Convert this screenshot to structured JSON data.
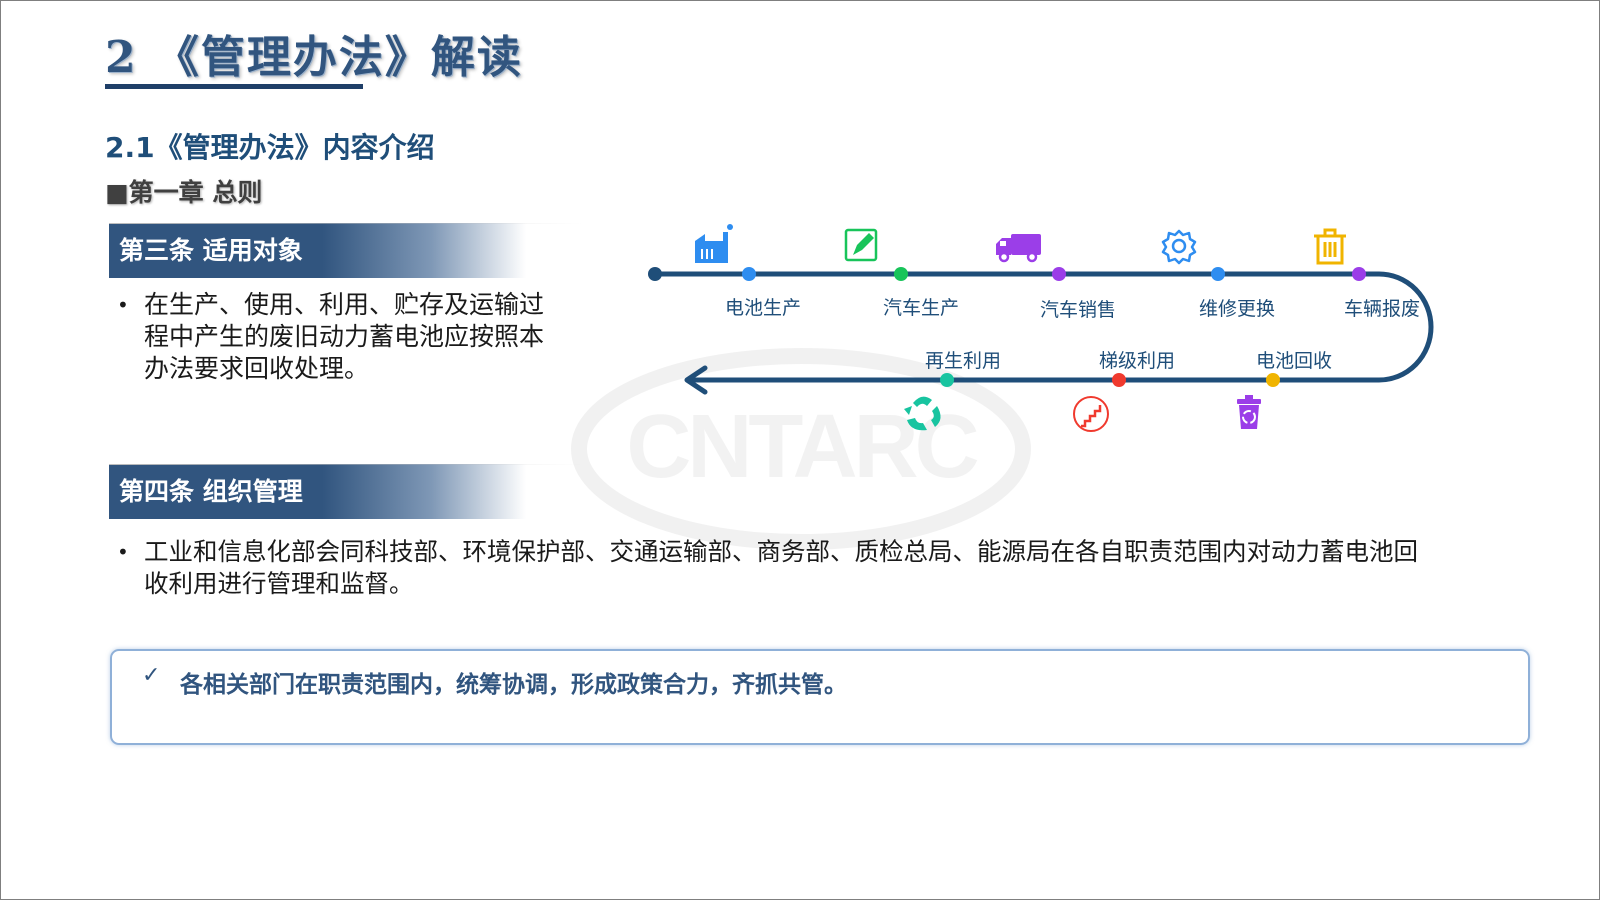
{
  "header": {
    "title": "2 《管理办法》解读",
    "subtitle": "2.1《管理办法》内容介绍",
    "chapter": "■第一章 总则"
  },
  "article3": {
    "heading": "第三条 适用对象",
    "bullet_symbol": "•",
    "lines": [
      "在生产、使用、利用、贮存及运输过",
      "程中产生的废旧动力蓄电池应按照本",
      "办法要求回收处理。"
    ]
  },
  "article4": {
    "heading": "第四条 组织管理",
    "bullet_symbol": "•",
    "lines": [
      "工业和信息化部会同科技部、环境保护部、交通运输部、商务部、质检总局、能源局在各自职责范围内对动力蓄电池回",
      "收利用进行管理和监督。"
    ]
  },
  "note": {
    "check": "✓",
    "text": "各相关部门在职责范围内，统筹协调，形成政策合力，齐抓共管。"
  },
  "watermark": {
    "text": "CNTARC"
  },
  "flow": {
    "top_stages": [
      {
        "label": "电池生产",
        "icon": "factory-icon",
        "dot_color": "#2e8df0"
      },
      {
        "label": "汽车生产",
        "icon": "edit-icon",
        "dot_color": "#18c45a"
      },
      {
        "label": "汽车销售",
        "icon": "truck-icon",
        "dot_color": "#9b3ee8"
      },
      {
        "label": "维修更换",
        "icon": "gear-icon",
        "dot_color": "#2e8df0"
      },
      {
        "label": "车辆报废",
        "icon": "trash-icon",
        "dot_color": "#9b3ee8"
      }
    ],
    "bottom_stages": [
      {
        "label": "电池回收",
        "icon": "recycle-bin-icon",
        "dot_color": "#f0b400"
      },
      {
        "label": "梯级利用",
        "icon": "stairs-icon",
        "dot_color": "#f03a2e"
      },
      {
        "label": "再生利用",
        "icon": "recycle-icon",
        "dot_color": "#18c4a0"
      }
    ],
    "line_color": "#1f4e79"
  }
}
